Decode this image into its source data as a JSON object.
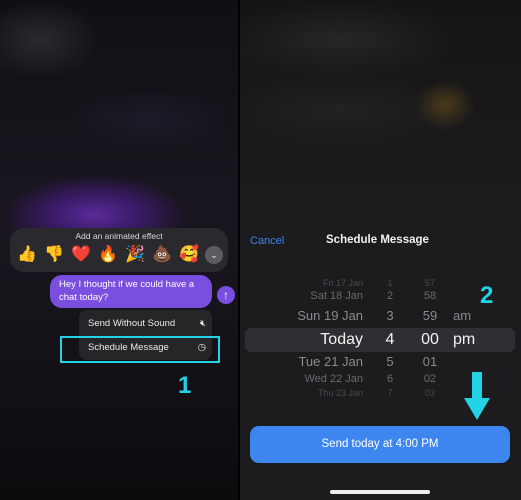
{
  "left": {
    "effects_title": "Add an animated effect",
    "emojis": [
      "👍",
      "👎",
      "❤️",
      "🔥",
      "🎉",
      "💩",
      "🥰"
    ],
    "message": "Hey I thought if we could have a chat today?",
    "menu": [
      {
        "label": "Send Without Sound",
        "icon": "speaker-muted-icon"
      },
      {
        "label": "Schedule Message",
        "icon": "clock-icon"
      }
    ],
    "step": "1"
  },
  "right": {
    "cancel": "Cancel",
    "title": "Schedule Message",
    "step": "2",
    "picker": [
      {
        "date": "Fri 17 Jan",
        "hour": "1",
        "minute": "57",
        "ampm": ""
      },
      {
        "date": "Sat 18 Jan",
        "hour": "2",
        "minute": "58",
        "ampm": ""
      },
      {
        "date": "Sun 19 Jan",
        "hour": "3",
        "minute": "59",
        "ampm": "am"
      },
      {
        "date": "Today",
        "hour": "4",
        "minute": "00",
        "ampm": "pm"
      },
      {
        "date": "Tue 21 Jan",
        "hour": "5",
        "minute": "01",
        "ampm": ""
      },
      {
        "date": "Wed 22 Jan",
        "hour": "6",
        "minute": "02",
        "ampm": ""
      },
      {
        "date": "Thu 23 Jan",
        "hour": "7",
        "minute": "03",
        "ampm": ""
      }
    ],
    "send_label": "Send today at 4:00 PM"
  },
  "colors": {
    "accent": "#3d86f0",
    "highlight": "#22d3e6",
    "bubble": "#7a4fe0"
  }
}
